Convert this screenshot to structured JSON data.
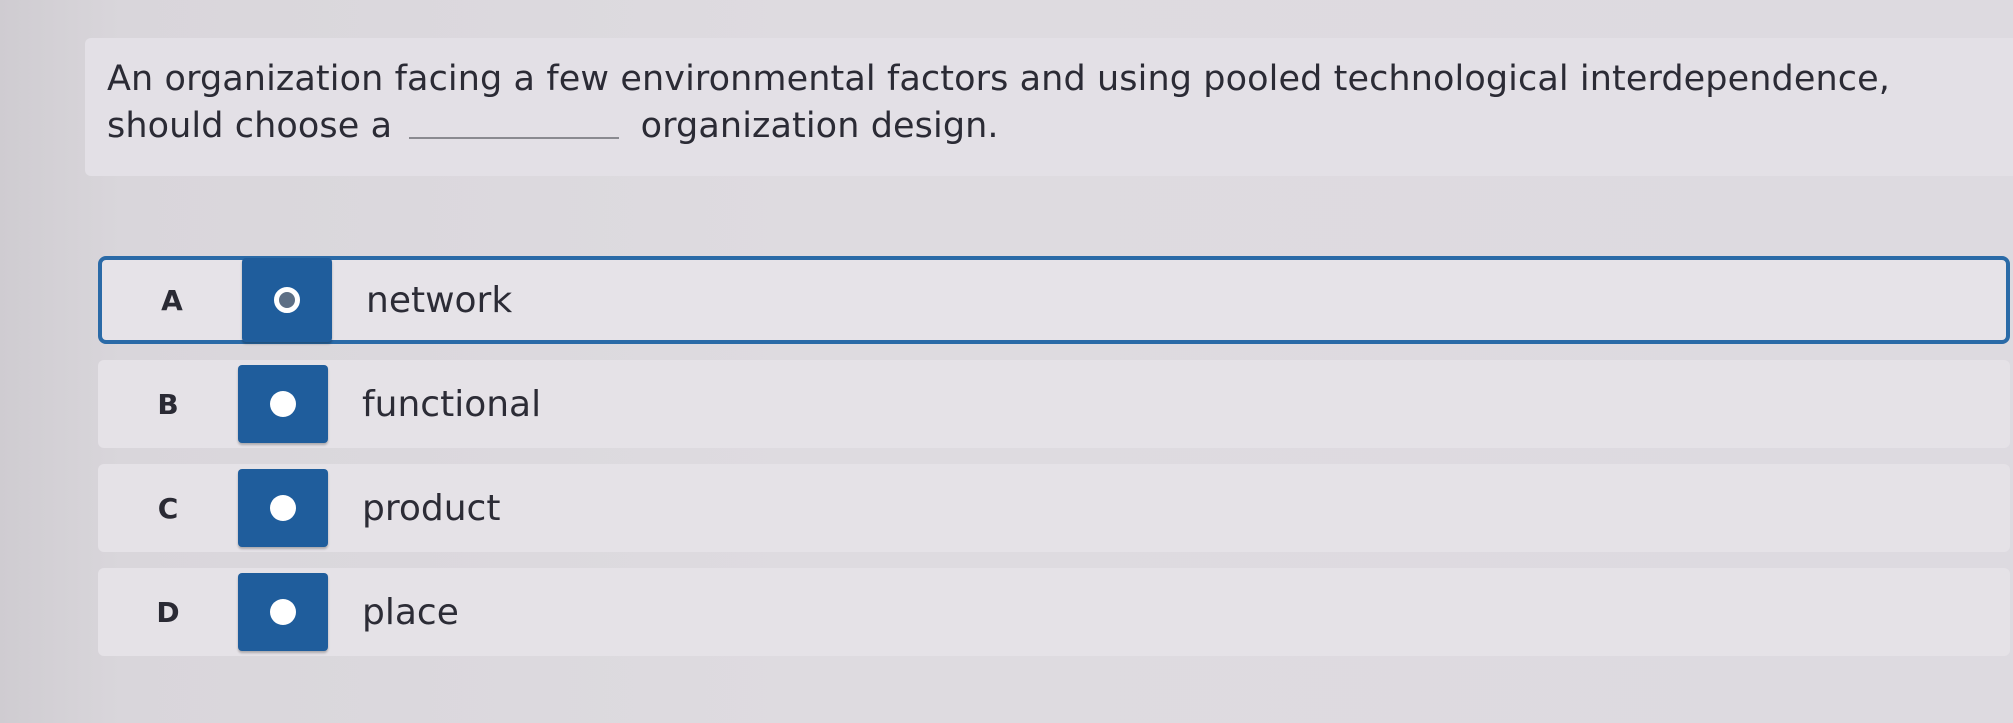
{
  "question": {
    "text_before": "An organization facing a few environmental factors and using pooled technological interdependence, should choose a",
    "text_after": "organization design."
  },
  "options": [
    {
      "letter": "A",
      "label": "network",
      "selected": true
    },
    {
      "letter": "B",
      "label": "functional",
      "selected": false
    },
    {
      "letter": "C",
      "label": "product",
      "selected": false
    },
    {
      "letter": "D",
      "label": "place",
      "selected": false
    }
  ],
  "colors": {
    "accent": "#1f5d9c",
    "selected_border": "#2a6aa7"
  },
  "icons": {
    "radio": "radio-button-icon"
  }
}
